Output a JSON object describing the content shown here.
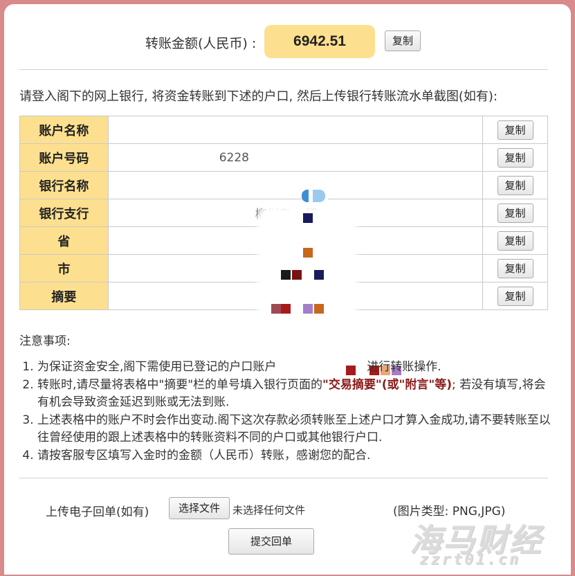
{
  "amount": {
    "label": "转账金额(人民币) :",
    "value": "6942.51",
    "copy_label": "复制"
  },
  "instruction": "请登入阁下的网上银行, 将资金转账到下述的户口, 然后上传银行转账流水单截图(如有):",
  "account_table": {
    "copy_label": "复制",
    "rows": [
      {
        "label": "账户名称",
        "value": ""
      },
      {
        "label": "账户号码",
        "value": "6228"
      },
      {
        "label": "银行名称",
        "value": ""
      },
      {
        "label": "银行支行",
        "value": "柳州东    行"
      },
      {
        "label": "省",
        "value": ""
      },
      {
        "label": "市",
        "value": ""
      },
      {
        "label": "摘要",
        "value": ""
      }
    ]
  },
  "notes": {
    "title": "注意事项:",
    "items": [
      {
        "parts": [
          "为保证资金安全,阁下需使用已登记的户口账户",
          "进行转账操作."
        ]
      },
      {
        "before": "转账时,请尽量将表格中\"摘要\"栏的单号填入银行",
        "mid": "页面的",
        "highlight": "\"交易摘要\"(或\"附言\"等)",
        "after": "; 若没有填写,将会有机会导致资金延迟到账或无法到账."
      },
      {
        "text": "上述表格中的账户不时会作出变动.阁下这次存款必须转账至上述户口才算入金成功,请不要转账至以往曾经使用的跟上述表格中的转账资料不同的户口或其他银行户口."
      },
      {
        "text": "请按客服专区填写入金时的金额（人民币）转账，感谢您的配合."
      }
    ]
  },
  "upload": {
    "label": "上传电子回单(如有)",
    "choose_label": "选择文件",
    "no_file": "未选择任何文件",
    "image_types": "(图片类型: PNG,JPG)",
    "submit_label": "提交回单"
  },
  "watermark": {
    "cn": "海马财经",
    "en": "zzrt01.cn"
  },
  "colors": {
    "accent": "#fde08f",
    "frame": "#d98a8a",
    "highlight": "#8b1a1a"
  }
}
